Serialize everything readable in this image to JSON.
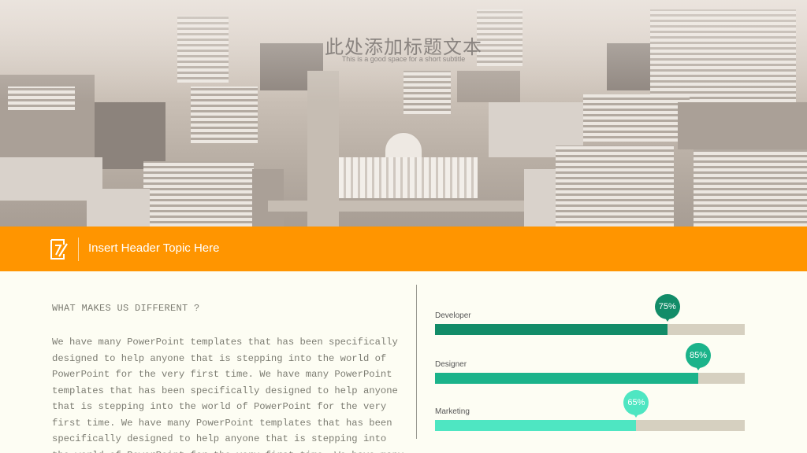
{
  "hero": {
    "title": "此处添加标题文本",
    "subtitle": "This is a good space for a short subtitle"
  },
  "header_band": {
    "title": "Insert Header Topic Here",
    "icon": "edit-note-icon",
    "color": "#ff9500"
  },
  "content": {
    "heading": "WHAT MAKES US DIFFERENT ?",
    "body": "We have many PowerPoint templates that has been specifically designed to help anyone that is stepping into the world of PowerPoint for the very first time. We have many PowerPoint templates that has been specifically designed to help anyone that is stepping into the world of PowerPoint for the very first time. We have many PowerPoint templates that has been specifically designed to help anyone that is stepping into the world of PowerPoint for the very first time. We have many"
  },
  "skills": [
    {
      "label": "Developer",
      "percent_label": "75%",
      "value": 0.75,
      "color": "#128c68"
    },
    {
      "label": "Designer",
      "percent_label": "85%",
      "value": 0.85,
      "color": "#1bb38a"
    },
    {
      "label": "Marketing",
      "percent_label": "65%",
      "value": 0.65,
      "color": "#4ee6c2"
    }
  ],
  "colors": {
    "track": "#d6d0c0",
    "background": "#fdfdf3"
  }
}
